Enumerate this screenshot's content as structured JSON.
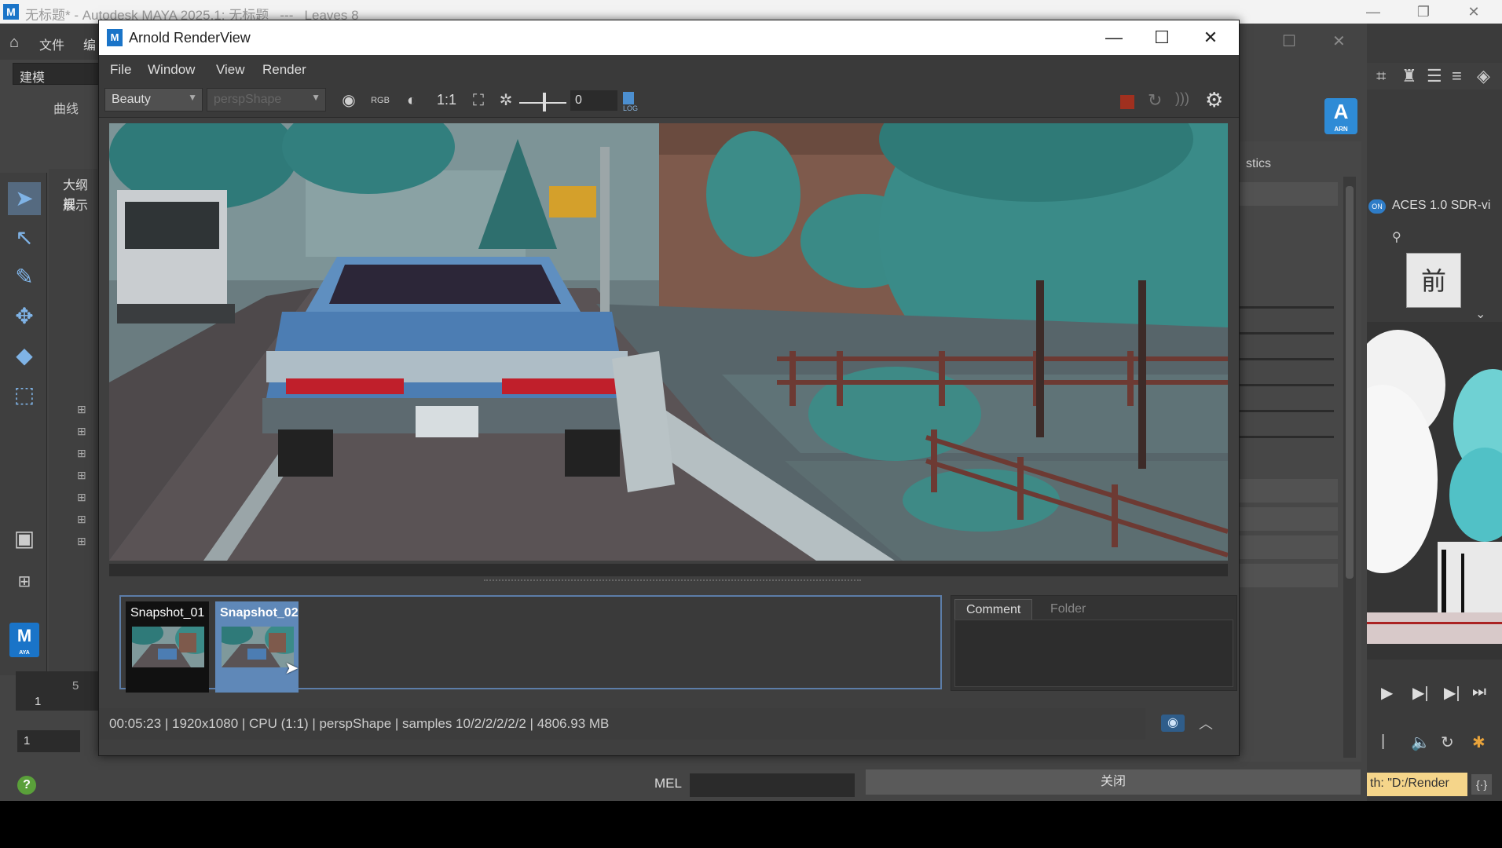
{
  "maya": {
    "titlebar": {
      "title": "无标题* - Autodesk MAYA 2025.1: 无标题   ---   Leaves 8",
      "logo": "M",
      "min": "—",
      "max": "❐",
      "close": "✕"
    },
    "menu": {
      "home_icon": "home-icon",
      "file": "文件",
      "edit": "编"
    },
    "mode": "建模",
    "shelf_tab": "曲线",
    "outliner": {
      "label1": "大纲视",
      "label2": "展示"
    },
    "badge": {
      "letter": "M",
      "sub": "AYA"
    },
    "timeline": {
      "tick5": "5",
      "tick1": "1",
      "frame": "1"
    },
    "help": "?",
    "mel_label": "MEL",
    "close_button": "关闭",
    "right_panel": {
      "tab_label": "stics"
    },
    "arnold_badge": {
      "letter": "A",
      "sub": "ARN"
    },
    "viewport": {
      "aces_toggle": "ON",
      "aces_label": "ACES 1.0 SDR-vi",
      "view_cube": "前",
      "path_label": "th: \"D:/Render"
    }
  },
  "renderview": {
    "title": "Arnold RenderView",
    "logo": "M",
    "controls": {
      "min": "—",
      "max": "☐",
      "close": "✕"
    },
    "menu": [
      "File",
      "Window",
      "View",
      "Render"
    ],
    "toolbar": {
      "aov": "Beauty",
      "camera": "perspShape",
      "ratio": "1:1",
      "exposure": "0",
      "log_label": "LOG"
    },
    "snapshots": [
      {
        "label": "Snapshot_01",
        "selected": false
      },
      {
        "label": "Snapshot_02",
        "selected": true
      }
    ],
    "notes_tabs": {
      "comment": "Comment",
      "folder": "Folder"
    },
    "status": "00:05:23 | 1920x1080 | CPU (1:1) | perspShape | samples 10/2/2/2/2/2 | 4806.93 MB",
    "colors": {
      "accent": "#5c7da8",
      "stop": "#a0301f",
      "selected_snapshot": "#5f88b8"
    }
  }
}
